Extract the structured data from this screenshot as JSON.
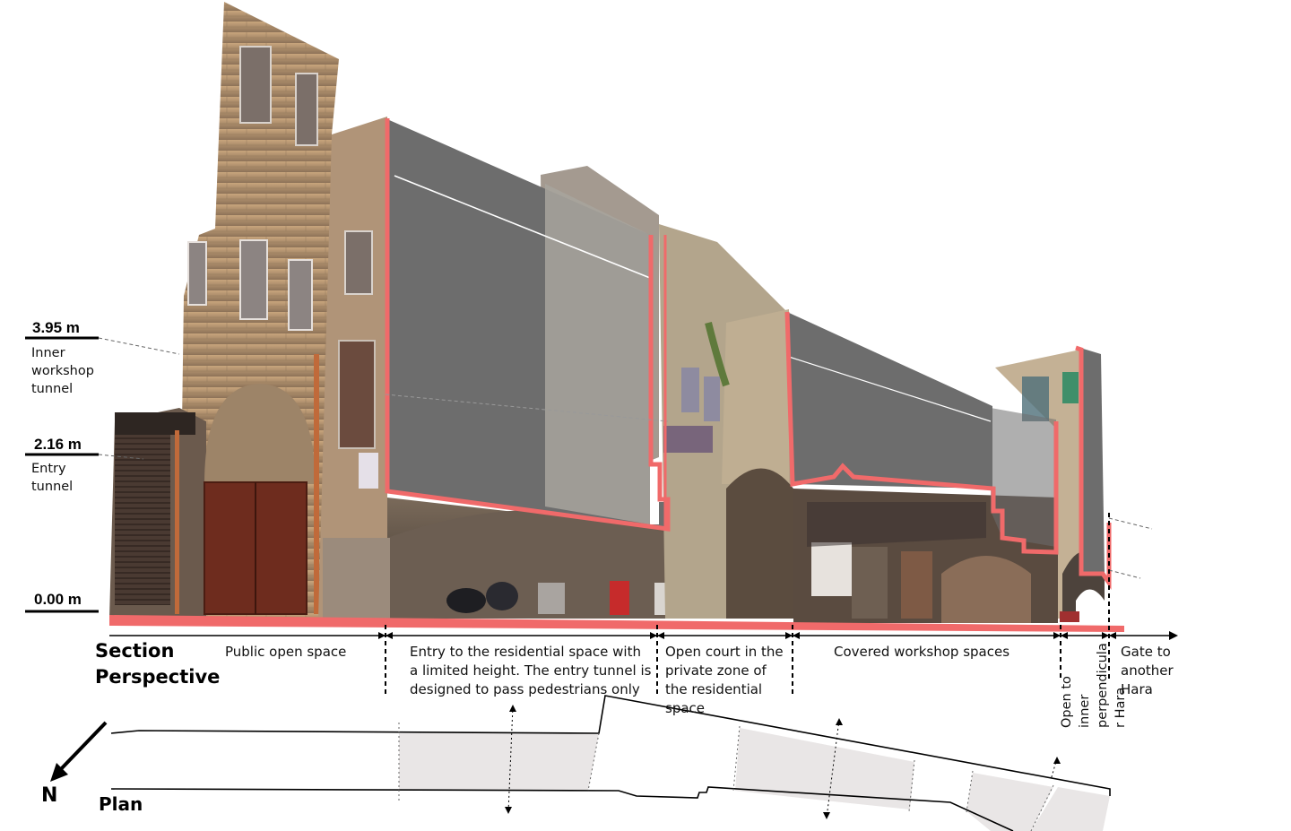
{
  "levels": [
    {
      "value": "3.95 m",
      "desc": "Inner workshop tunnel"
    },
    {
      "value": "2.16 m",
      "desc": "Entry tunnel"
    },
    {
      "value": "0.00 m",
      "desc": ""
    }
  ],
  "section_title_1": "Section",
  "section_title_2": "Perspective",
  "plan_label": "Plan",
  "north_label": "N",
  "zones": {
    "public": "Public open space",
    "entry": "Entry to the residential space with a limited height. The entry tunnel is designed to pass pedestrians only",
    "court": "Open court in the private zone of the residential space",
    "workshop": "Covered workshop spaces",
    "open_inner_1": "Open to",
    "open_inner_2": "inner",
    "open_inner_3": "perpendicula",
    "open_inner_4": "r Hara",
    "gate": "Gate to another Hara"
  },
  "colors": {
    "section_cut": "#f06a6a",
    "mass_fill": "#6d6d6d",
    "stone": "#b8956e",
    "plan_shade": "#e9e6e6"
  }
}
